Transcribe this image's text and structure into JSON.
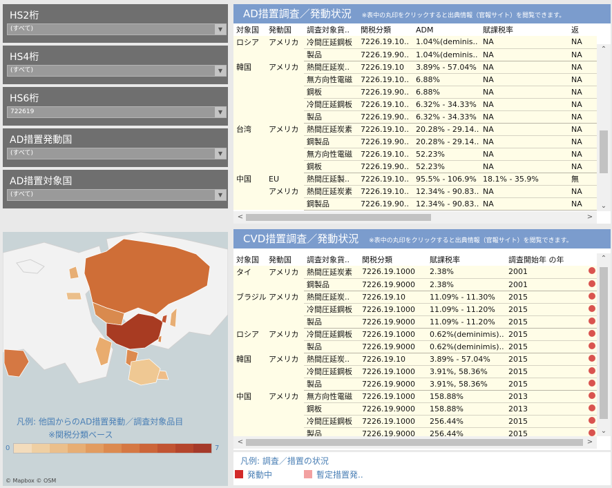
{
  "filters": [
    {
      "label": "HS2桁",
      "value": "(すべて)"
    },
    {
      "label": "HS4桁",
      "value": "(すべて)"
    },
    {
      "label": "HS6桁",
      "value": "722619"
    },
    {
      "label": "AD措置発動国",
      "value": "(すべて)"
    },
    {
      "label": "AD措置対象国",
      "value": "(すべて)"
    }
  ],
  "map": {
    "legend_line1": "凡例:  他国からのAD措置発動／調査対象品目",
    "legend_line2": "※関税分類ベース",
    "ramp_min": "0",
    "ramp_max": "7",
    "attribution": "© Mapbox © OSM",
    "ramp_colors": [
      "#f3dcbc",
      "#efcfa3",
      "#ebbf8b",
      "#e7ae74",
      "#e29c60",
      "#dc8a4f",
      "#d57843",
      "#cc6539",
      "#c15432",
      "#b4452c",
      "#a53a2a"
    ]
  },
  "ad": {
    "title": "AD措置調査／発動状況",
    "note": "※表中の丸印をクリックすると出典情報（官報サイト）を閲覧できます。",
    "headers": [
      "対象国",
      "発動国",
      "調査対象貨..",
      "関税分類",
      "ADM",
      "賦課税率",
      "返"
    ],
    "rows": [
      {
        "c1": "ロシア",
        "c2": "アメリカ",
        "c3": "冷間圧延鋼板",
        "c4": "7226.19.10..",
        "c5": "1.04%(deminis..",
        "c6": "NA",
        "c7": "NA"
      },
      {
        "c1": "",
        "c2": "",
        "c3": "製品",
        "c4": "7226.19.90..",
        "c5": "1.04%(deminis..",
        "c6": "NA",
        "c7": "NA"
      },
      {
        "c1": "韓国",
        "c2": "アメリカ",
        "c3": "熱間圧延炭..",
        "c4": "7226.19.10",
        "c5": "3.89% - 57.04%",
        "c6": "NA",
        "c7": "NA"
      },
      {
        "c1": "",
        "c2": "",
        "c3": "無方向性電磁",
        "c4": "7226.19.10..",
        "c5": "6.88%",
        "c6": "NA",
        "c7": "NA"
      },
      {
        "c1": "",
        "c2": "",
        "c3": "鋼板",
        "c4": "7226.19.90..",
        "c5": "6.88%",
        "c6": "NA",
        "c7": "NA"
      },
      {
        "c1": "",
        "c2": "",
        "c3": "冷間圧延鋼板",
        "c4": "7226.19.10..",
        "c5": "6.32% - 34.33%",
        "c6": "NA",
        "c7": "NA"
      },
      {
        "c1": "",
        "c2": "",
        "c3": "製品",
        "c4": "7226.19.90..",
        "c5": "6.32% - 34.33%",
        "c6": "NA",
        "c7": "NA"
      },
      {
        "c1": "台湾",
        "c2": "アメリカ",
        "c3": "熱間圧延炭素",
        "c4": "7226.19.10..",
        "c5": "20.28% - 29.14..",
        "c6": "NA",
        "c7": "NA"
      },
      {
        "c1": "",
        "c2": "",
        "c3": "鋼製品",
        "c4": "7226.19.90..",
        "c5": "20.28% - 29.14..",
        "c6": "NA",
        "c7": "NA"
      },
      {
        "c1": "",
        "c2": "",
        "c3": "無方向性電磁",
        "c4": "7226.19.10..",
        "c5": "52.23%",
        "c6": "NA",
        "c7": "NA"
      },
      {
        "c1": "",
        "c2": "",
        "c3": "鋼板",
        "c4": "7226.19.90..",
        "c5": "52.23%",
        "c6": "NA",
        "c7": "NA"
      },
      {
        "c1": "中国",
        "c2": "EU",
        "c3": "熱間圧延製..",
        "c4": "7226.19.10..",
        "c5": "95.5% - 106.9%",
        "c6": "18.1% - 35.9%",
        "c7": "無"
      },
      {
        "c1": "",
        "c2": "アメリカ",
        "c3": "熱間圧延炭素",
        "c4": "7226.19.10..",
        "c5": "12.34% - 90.83..",
        "c6": "NA",
        "c7": "NA"
      },
      {
        "c1": "",
        "c2": "",
        "c3": "鋼製品",
        "c4": "7226.19.90..",
        "c5": "12.34% - 90.83..",
        "c6": "NA",
        "c7": "NA"
      }
    ]
  },
  "cvd": {
    "title": "CVD措置調査／発動状況",
    "note": "※表中の丸印をクリックすると出典情報（官報サイト）を閲覧できます。",
    "headers": [
      "対象国",
      "発動国",
      "調査対象貨..",
      "関税分類",
      "賦課税率",
      "調査開始年 の年",
      ""
    ],
    "rows": [
      {
        "c1": "タイ",
        "c2": "アメリカ",
        "c3": "熱間圧延炭素",
        "c4": "7226.19.1000",
        "c5": "2.38%",
        "c6": "2001"
      },
      {
        "c1": "",
        "c2": "",
        "c3": "鋼製品",
        "c4": "7226.19.9000",
        "c5": "2.38%",
        "c6": "2001"
      },
      {
        "c1": "ブラジル",
        "c2": "アメリカ",
        "c3": "熱間圧延炭..",
        "c4": "7226.19.10",
        "c5": "11.09% - 11.30%",
        "c6": "2015"
      },
      {
        "c1": "",
        "c2": "",
        "c3": "冷間圧延鋼板",
        "c4": "7226.19.1000",
        "c5": "11.09% - 11.20%",
        "c6": "2015"
      },
      {
        "c1": "",
        "c2": "",
        "c3": "製品",
        "c4": "7226.19.9000",
        "c5": "11.09% - 11.20%",
        "c6": "2015"
      },
      {
        "c1": "ロシア",
        "c2": "アメリカ",
        "c3": "冷間圧延鋼板",
        "c4": "7226.19.1000",
        "c5": "0.62%(deminimis)..",
        "c6": "2015"
      },
      {
        "c1": "",
        "c2": "",
        "c3": "製品",
        "c4": "7226.19.9000",
        "c5": "0.62%(deminimis)..",
        "c6": "2015"
      },
      {
        "c1": "韓国",
        "c2": "アメリカ",
        "c3": "熱間圧延炭..",
        "c4": "7226.19.10",
        "c5": "3.89% - 57.04%",
        "c6": "2015"
      },
      {
        "c1": "",
        "c2": "",
        "c3": "冷間圧延鋼板",
        "c4": "7226.19.1000",
        "c5": "3.91%, 58.36%",
        "c6": "2015"
      },
      {
        "c1": "",
        "c2": "",
        "c3": "製品",
        "c4": "7226.19.9000",
        "c5": "3.91%, 58.36%",
        "c6": "2015"
      },
      {
        "c1": "中国",
        "c2": "アメリカ",
        "c3": "無方向性電磁",
        "c4": "7226.19.1000",
        "c5": "158.88%",
        "c6": "2013"
      },
      {
        "c1": "",
        "c2": "",
        "c3": "鋼板",
        "c4": "7226.19.9000",
        "c5": "158.88%",
        "c6": "2013"
      },
      {
        "c1": "",
        "c2": "",
        "c3": "冷間圧延鋼板",
        "c4": "7226.19.1000",
        "c5": "256.44%",
        "c6": "2015"
      },
      {
        "c1": "",
        "c2": "",
        "c3": "製品",
        "c4": "7226.19.9000",
        "c5": "256.44%",
        "c6": "2015"
      }
    ]
  },
  "legend2": {
    "title": "凡例:  調査／措置の状況",
    "items": [
      {
        "label": "発動中",
        "color": "#d22a2a"
      },
      {
        "label": "暫定措置発..",
        "color": "#f2a0a0"
      }
    ]
  }
}
